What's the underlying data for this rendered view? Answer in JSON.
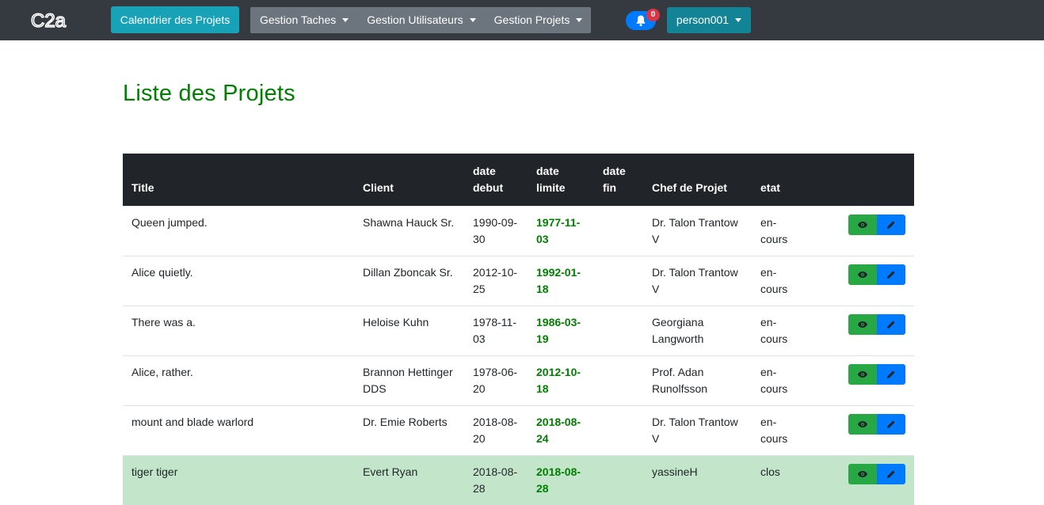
{
  "navbar": {
    "logo_text": "C2a",
    "calendar_button": "Calendrier des Projets",
    "menus": [
      "Gestion Taches",
      "Gestion Utilisateurs",
      "Gestion Projets"
    ],
    "notification_count": "0",
    "user": "person001"
  },
  "page": {
    "title": "Liste des Projets"
  },
  "table": {
    "headers": {
      "title": "Title",
      "client": "Client",
      "date_debut_1": "date",
      "date_debut_2": "debut",
      "date_limite_1": "date",
      "date_limite_2": "limite",
      "date_fin_1": "date",
      "date_fin_2": "fin",
      "chef": "Chef de Projet",
      "etat": "etat"
    },
    "rows": [
      {
        "title": "Queen jumped.",
        "client": "Shawna Hauck Sr.",
        "debut": "1990-09-30",
        "limite": "1977-11-03",
        "fin": "",
        "chef": "Dr. Talon Trantow V",
        "etat": "en-cours"
      },
      {
        "title": "Alice quietly.",
        "client": "Dillan Zboncak Sr.",
        "debut": "2012-10-25",
        "limite": "1992-01-18",
        "fin": "",
        "chef": "Dr. Talon Trantow V",
        "etat": "en-cours"
      },
      {
        "title": "There was a.",
        "client": "Heloise Kuhn",
        "debut": "1978-11-03",
        "limite": "1986-03-19",
        "fin": "",
        "chef": "Georgiana Langworth",
        "etat": "en-cours"
      },
      {
        "title": "Alice, rather.",
        "client": "Brannon Hettinger DDS",
        "debut": "1978-06-20",
        "limite": "2012-10-18",
        "fin": "",
        "chef": "Prof. Adan Runolfsson",
        "etat": "en-cours"
      },
      {
        "title": "mount and blade warlord",
        "client": "Dr. Emie Roberts",
        "debut": "2018-08-20",
        "limite": "2018-08-24",
        "fin": "",
        "chef": "Dr. Talon Trantow V",
        "etat": "en-cours"
      },
      {
        "title": "tiger tiger",
        "client": "Evert Ryan",
        "debut": "2018-08-28",
        "limite": "2018-08-28",
        "fin": "",
        "chef": "yassineH",
        "etat": "clos"
      }
    ]
  },
  "colors": {
    "navbar": "#343a40",
    "calendar_button": "#17a2b8",
    "title_green": "#008000",
    "view_button": "#28a745",
    "edit_button": "#007bff",
    "closed_row": "#c3e6cb"
  },
  "icons": {
    "view": "eye-icon",
    "edit": "pencil-icon",
    "notification": "bell-icon"
  }
}
